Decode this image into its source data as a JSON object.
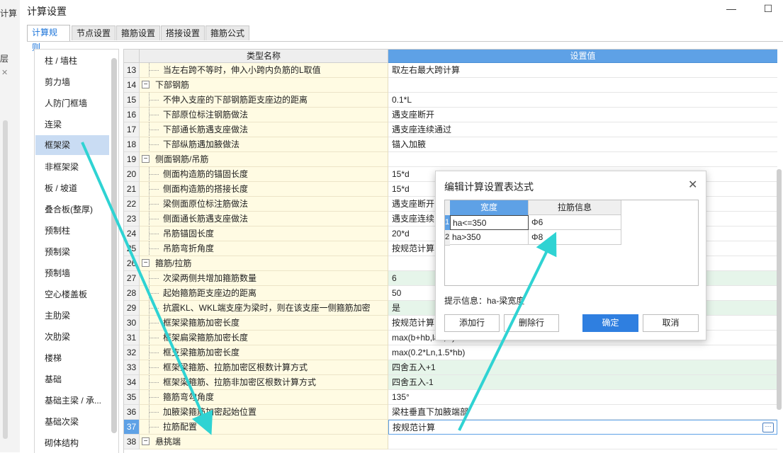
{
  "background_app": {
    "title_fragment": "计算",
    "label_fragment": "层"
  },
  "dialog": {
    "title": "计算设置",
    "minimize_label": "—",
    "maximize_label": "☐"
  },
  "tabs": [
    {
      "label": "计算规则",
      "active": true
    },
    {
      "label": "节点设置",
      "active": false
    },
    {
      "label": "箍筋设置",
      "active": false
    },
    {
      "label": "搭接设置",
      "active": false
    },
    {
      "label": "箍筋公式",
      "active": false
    }
  ],
  "nav": {
    "selected": "框架梁",
    "items": [
      "柱 / 墙柱",
      "剪力墙",
      "人防门框墙",
      "连梁",
      "框架梁",
      "非框架梁",
      "板 / 坡道",
      "叠合板(整厚)",
      "预制柱",
      "预制梁",
      "预制墙",
      "空心楼盖板",
      "主肋梁",
      "次肋梁",
      "楼梯",
      "基础",
      "基础主梁 / 承...",
      "基础次梁",
      "砌体结构"
    ]
  },
  "grid": {
    "col_name": "类型名称",
    "col_value": "设置值",
    "rows": [
      {
        "n": "13",
        "name": "当左右跨不等时，伸入小跨内负筋的L取值",
        "value": "取左右最大跨计算",
        "kind": "sub",
        "hl": ""
      },
      {
        "n": "14",
        "name": "下部钢筋",
        "value": "",
        "kind": "grp",
        "hl": ""
      },
      {
        "n": "15",
        "name": "不伸入支座的下部钢筋距支座边的距离",
        "value": "0.1*L",
        "kind": "sub",
        "hl": ""
      },
      {
        "n": "16",
        "name": "下部原位标注钢筋做法",
        "value": "遇支座断开",
        "kind": "sub",
        "hl": ""
      },
      {
        "n": "17",
        "name": "下部通长筋遇支座做法",
        "value": "遇支座连续通过",
        "kind": "sub",
        "hl": ""
      },
      {
        "n": "18",
        "name": "下部纵筋遇加腋做法",
        "value": "锚入加腋",
        "kind": "sub",
        "hl": ""
      },
      {
        "n": "19",
        "name": "侧面钢筋/吊筋",
        "value": "",
        "kind": "grp",
        "hl": ""
      },
      {
        "n": "20",
        "name": "侧面构造筋的锚固长度",
        "value": "15*d",
        "kind": "sub",
        "hl": ""
      },
      {
        "n": "21",
        "name": "侧面构造筋的搭接长度",
        "value": "15*d",
        "kind": "sub",
        "hl": ""
      },
      {
        "n": "22",
        "name": "梁侧面原位标注筋做法",
        "value": "遇支座断开",
        "kind": "sub",
        "hl": ""
      },
      {
        "n": "23",
        "name": "侧面通长筋遇支座做法",
        "value": "遇支座连续",
        "kind": "sub",
        "hl": ""
      },
      {
        "n": "24",
        "name": "吊筋锚固长度",
        "value": "20*d",
        "kind": "sub",
        "hl": ""
      },
      {
        "n": "25",
        "name": "吊筋弯折角度",
        "value": "按规范计算",
        "kind": "sub",
        "hl": ""
      },
      {
        "n": "26",
        "name": "箍筋/拉筋",
        "value": "",
        "kind": "grp",
        "hl": ""
      },
      {
        "n": "27",
        "name": "次梁两侧共增加箍筋数量",
        "value": "6",
        "kind": "sub",
        "hl": "green"
      },
      {
        "n": "28",
        "name": "起始箍筋距支座边的距离",
        "value": "50",
        "kind": "sub",
        "hl": ""
      },
      {
        "n": "29",
        "name": "抗震KL、WKL端支座为梁时，则在该支座一侧箍筋加密",
        "value": "是",
        "kind": "sub",
        "hl": "green"
      },
      {
        "n": "30",
        "name": "框架梁箍筋加密长度",
        "value": "按规范计算",
        "kind": "sub",
        "hl": ""
      },
      {
        "n": "31",
        "name": "框架扁梁箍筋加密长度",
        "value": "max(b+hb,lae,C)",
        "kind": "sub",
        "hl": ""
      },
      {
        "n": "32",
        "name": "框支梁箍筋加密长度",
        "value": "max(0.2*Ln,1.5*hb)",
        "kind": "sub",
        "hl": ""
      },
      {
        "n": "33",
        "name": "框架梁箍筋、拉筋加密区根数计算方式",
        "value": "四舍五入+1",
        "kind": "sub",
        "hl": "green"
      },
      {
        "n": "34",
        "name": "框架梁箍筋、拉筋非加密区根数计算方式",
        "value": "四舍五入-1",
        "kind": "sub",
        "hl": "green"
      },
      {
        "n": "35",
        "name": "箍筋弯勾角度",
        "value": "135°",
        "kind": "sub",
        "hl": ""
      },
      {
        "n": "36",
        "name": "加腋梁箍筋加密起始位置",
        "value": "梁柱垂直下加腋端部",
        "kind": "sub",
        "hl": ""
      },
      {
        "n": "37",
        "name": "拉筋配置",
        "value": "按规范计算",
        "kind": "sub",
        "hl": "edit"
      },
      {
        "n": "38",
        "name": "悬挑端",
        "value": "",
        "kind": "grp",
        "hl": ""
      }
    ]
  },
  "popup": {
    "title": "编辑计算设置表达式",
    "close_label": "✕",
    "col_width": "宽度",
    "col_tie": "拉筋信息",
    "rows": [
      {
        "n": "1",
        "width": "ha<=350",
        "tie": "Φ6"
      },
      {
        "n": "2",
        "width": "ha>350",
        "tie": "Φ8"
      }
    ],
    "hint": "提示信息：ha-梁宽度",
    "btn_add": "添加行",
    "btn_delete": "删除行",
    "btn_ok": "确定",
    "btn_cancel": "取消"
  },
  "colors": {
    "accent": "#2f7fe0",
    "header_blue": "#5ea1e6",
    "annotation_arrow": "#2fd3d3",
    "row_green": "#e6f5ea",
    "name_yellow": "#fffbe3"
  }
}
